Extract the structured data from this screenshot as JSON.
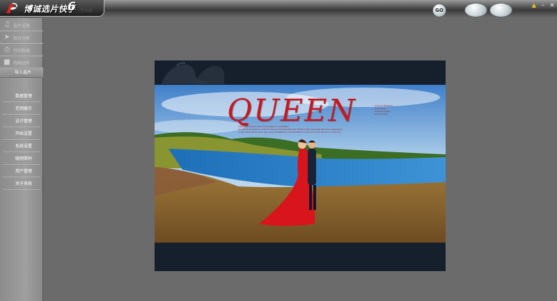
{
  "app": {
    "title": "博诚选片快手",
    "version": "6",
    "subtitle": "专业版"
  },
  "toolbar": {
    "go_label": "GO"
  },
  "window_controls": {
    "lock_icon": "lock-icon",
    "minimize_icon": "minimize-icon",
    "close_icon": "close-icon"
  },
  "sidebar": {
    "top_items": [
      {
        "label": "选片设备",
        "icon": "music-note-icon"
      },
      {
        "label": "后台分析",
        "icon": "pointer-icon"
      },
      {
        "label": "打印数据",
        "icon": "printer-icon"
      },
      {
        "label": "视图组件",
        "icon": "stamp-icon"
      }
    ],
    "import_label": "导入选片",
    "items": [
      {
        "label": "数据管理"
      },
      {
        "label": "范例展示"
      },
      {
        "label": "设计管理"
      },
      {
        "label": "开始设置"
      },
      {
        "label": "系统设置"
      },
      {
        "label": "联网密码"
      },
      {
        "label": "用户管理"
      },
      {
        "label": "关于系统"
      }
    ]
  },
  "preview": {
    "title": "QUEEN",
    "fineprint_center": [
      "Leaves in Autumn the Yi-can begin for transition",
      "the world we believe, hold for love as incomparable.GO 18YE4 pretty Specially Romance Opposition",
      "in the world hands each day, give a Heightfrom its Hairstillsoon and all to Romantone so Unite.Hii"
    ],
    "fineprint_right": [
      "Autumn Wedding",
      "Love Story",
      "Forever Queen",
      "Photo Studio"
    ],
    "colors": {
      "frame": "#161f2c",
      "title": "#c41a22",
      "dress": "#d8151c"
    }
  }
}
